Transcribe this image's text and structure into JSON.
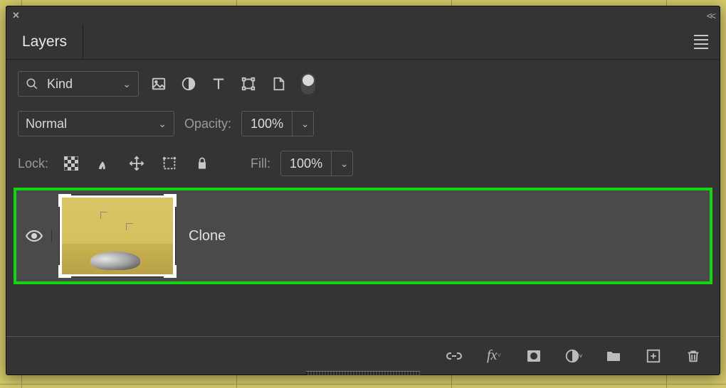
{
  "panel": {
    "tab_label": "Layers",
    "filter": {
      "kind_label": "Kind"
    },
    "icons": {
      "image": "image-icon",
      "adjust": "adjustment-icon",
      "type": "type-icon",
      "shape": "shape-icon",
      "smart": "smart-object-icon"
    },
    "blend": {
      "mode": "Normal",
      "opacity_label": "Opacity:",
      "opacity_value": "100%"
    },
    "lock": {
      "label": "Lock:",
      "fill_label": "Fill:",
      "fill_value": "100%"
    },
    "layers": [
      {
        "name": "Clone",
        "visible": true,
        "selected": true
      }
    ],
    "footer_icons": [
      "link",
      "fx",
      "mask",
      "adjustment",
      "group",
      "new",
      "trash"
    ]
  }
}
